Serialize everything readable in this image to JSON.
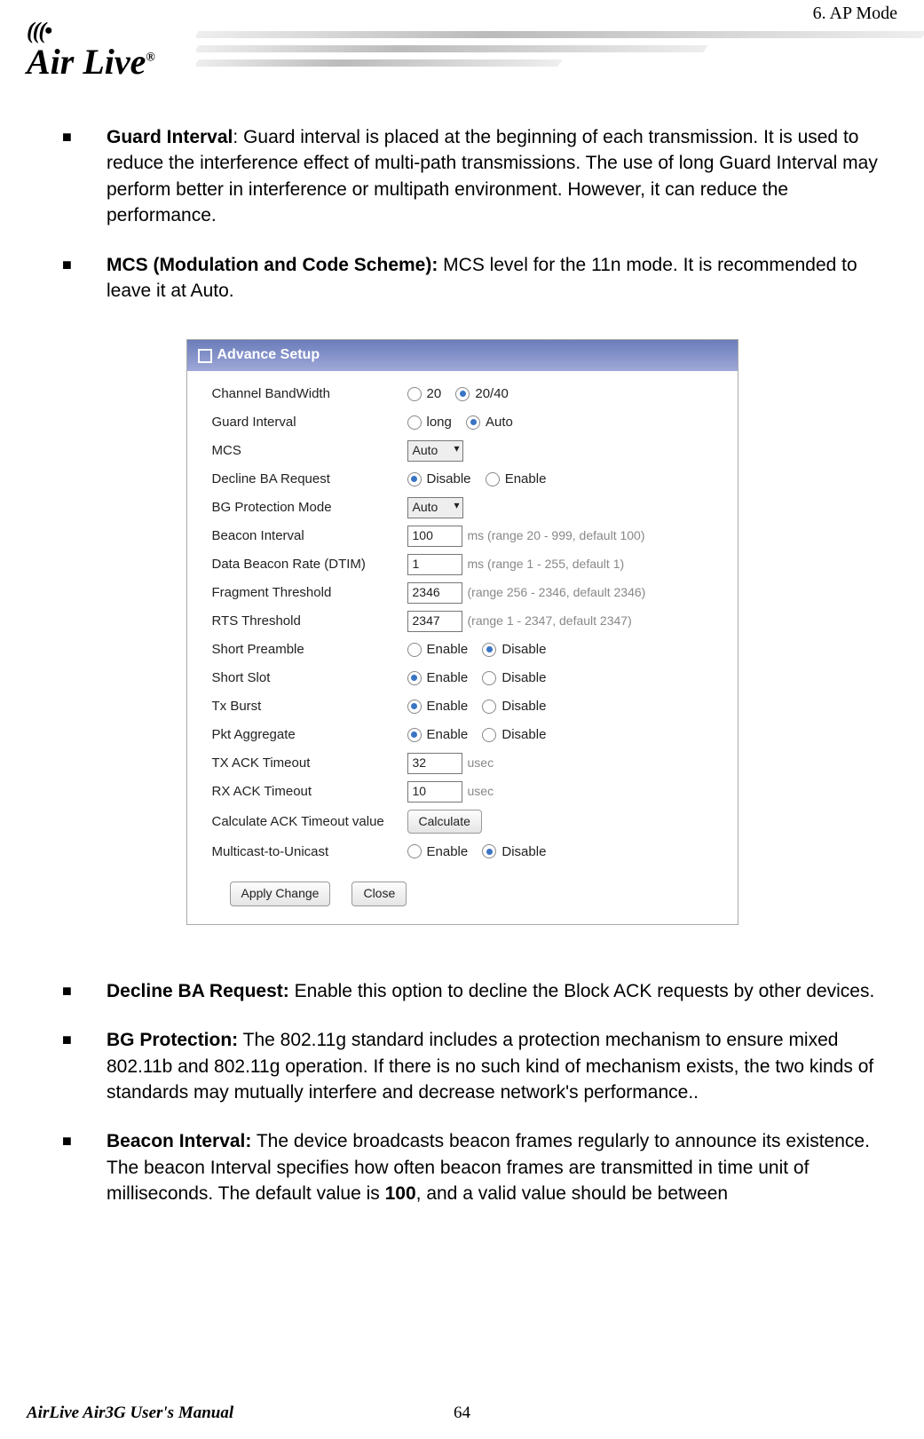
{
  "header": {
    "chapter": "6.   AP  Mode",
    "logo_text": "Air Live",
    "logo_reg": "®"
  },
  "bullets": {
    "guard_interval_title": "Guard Interval",
    "guard_interval_colon": ": ",
    "guard_interval_body": "Guard interval is placed at the beginning of each transmission.    It is used to reduce the interference effect of multi-path transmissions.    The use of long Guard Interval may perform better in interference or multipath environment.    However, it can reduce the performance.",
    "mcs_title": "MCS (Modulation and Code Scheme):",
    "mcs_body": " MCS level for the 11n mode.    It is recommended to leave it at Auto.",
    "decline_title": "Decline BA Request:",
    "decline_body": " Enable this option to decline the Block ACK requests by other devices.",
    "bg_title": "BG Protection:",
    "bg_body": "   The 802.11g standard includes a protection mechanism to ensure mixed 802.11b and 802.11g operation. If there is no such kind of mechanism exists, the two kinds of standards may mutually interfere and decrease network's performance..",
    "beacon_title_1": "Beacon Interval:",
    "beacon_body_1": " The device broadcasts beacon frames regularly to announce its existence. The beacon Interval specifies how often beacon frames are transmitted in time unit of milliseconds. The default value is ",
    "beacon_bold_100": "100",
    "beacon_body_2": ", and a valid value should be between"
  },
  "panel": {
    "title": "Advance Setup",
    "rows": {
      "channel_bw": {
        "label": "Channel BandWidth",
        "opts": [
          "20",
          "20/40"
        ],
        "checked": 1
      },
      "guard": {
        "label": "Guard Interval",
        "opts": [
          "long",
          "Auto"
        ],
        "checked": 1
      },
      "mcs": {
        "label": "MCS",
        "value": "Auto"
      },
      "decline": {
        "label": "Decline BA Request",
        "opts": [
          "Disable",
          "Enable"
        ],
        "checked": 0
      },
      "bg": {
        "label": "BG Protection Mode",
        "value": "Auto"
      },
      "beacon": {
        "label": "Beacon Interval",
        "value": "100",
        "hint": "ms (range 20 - 999, default 100)"
      },
      "dtim": {
        "label": "Data Beacon Rate (DTIM)",
        "value": "1",
        "hint": "ms (range 1 - 255, default 1)"
      },
      "frag": {
        "label": "Fragment Threshold",
        "value": "2346",
        "hint": "(range 256 - 2346, default 2346)"
      },
      "rts": {
        "label": "RTS Threshold",
        "value": "2347",
        "hint": "(range 1 - 2347, default 2347)"
      },
      "preamble": {
        "label": "Short Preamble",
        "opts": [
          "Enable",
          "Disable"
        ],
        "checked": 1
      },
      "slot": {
        "label": "Short Slot",
        "opts": [
          "Enable",
          "Disable"
        ],
        "checked": 0
      },
      "txburst": {
        "label": "Tx Burst",
        "opts": [
          "Enable",
          "Disable"
        ],
        "checked": 0
      },
      "pkt": {
        "label": "Pkt Aggregate",
        "opts": [
          "Enable",
          "Disable"
        ],
        "checked": 0
      },
      "txack": {
        "label": "TX ACK Timeout",
        "value": "32",
        "unit": "usec"
      },
      "rxack": {
        "label": "RX ACK Timeout",
        "value": "10",
        "unit": "usec"
      },
      "calc": {
        "label": "Calculate ACK Timeout value",
        "btn": "Calculate"
      },
      "multicast": {
        "label": "Multicast-to-Unicast",
        "opts": [
          "Enable",
          "Disable"
        ],
        "checked": 1
      }
    },
    "apply_btn": "Apply Change",
    "close_btn": "Close"
  },
  "footer": {
    "left": "AirLive Air3G User's Manual",
    "page": "64"
  }
}
